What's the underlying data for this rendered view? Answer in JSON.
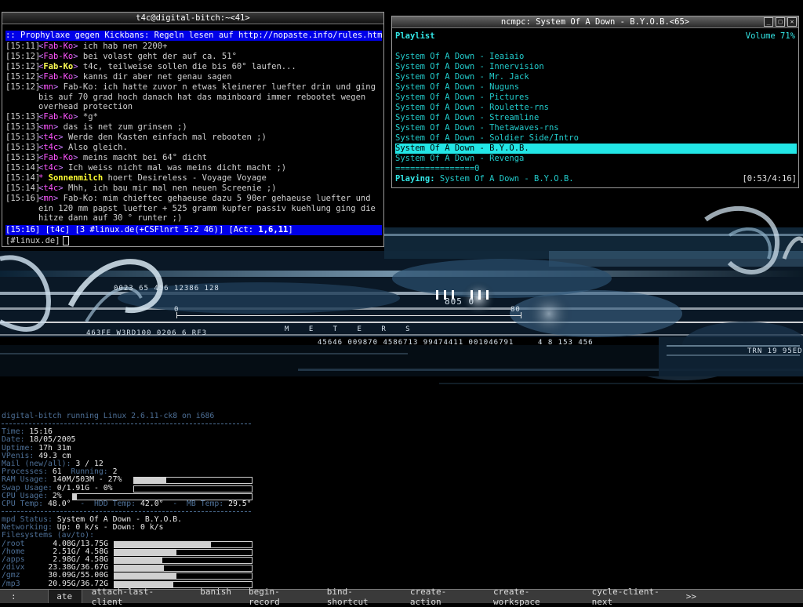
{
  "irc_window": {
    "title": "t4c@digital-bitch:~<41>",
    "topic": ":: Prophylaxe gegen Kickbans: Regeln lesen auf http://nopaste.info/rules.html :",
    "lines": [
      {
        "ts": "[15:11]",
        "nick": "Fab-Ko",
        "kind": "fab",
        "text": "ich hab nen 2200+"
      },
      {
        "ts": "[15:12]",
        "nick": "Fab-Ko",
        "kind": "fab",
        "text": "bei volast geht der auf ca. 51°"
      },
      {
        "ts": "[15:12]",
        "nick": "Fab-Ko",
        "kind": "fabhl",
        "text": "t4c, teilweise sollen die bis 60° laufen..."
      },
      {
        "ts": "[15:12]",
        "nick": "Fab-Ko",
        "kind": "fab",
        "text": "kanns dir aber net genau sagen"
      },
      {
        "ts": "[15:12]",
        "nick": "mn",
        "kind": "mn",
        "text": "Fab-Ko: ich hatte zuvor n etwas kleinerer luefter drin und ging bis auf 70 grad hoch danach hat das mainboard immer rebootet wegen overhead protection"
      },
      {
        "ts": "[15:13]",
        "nick": "Fab-Ko",
        "kind": "fab",
        "text": "*g*"
      },
      {
        "ts": "[15:13]",
        "nick": "mn",
        "kind": "mn",
        "text": "das is net zum grinsen ;)"
      },
      {
        "ts": "[15:13]",
        "nick": "t4c",
        "kind": "t4c",
        "text": "Werde den Kasten einfach mal rebooten ;)"
      },
      {
        "ts": "[15:13]",
        "nick": "t4c",
        "kind": "t4c",
        "text": "Also gleich."
      },
      {
        "ts": "[15:13]",
        "nick": "Fab-Ko",
        "kind": "fab",
        "text": "meins macht bei 64° dicht"
      },
      {
        "ts": "[15:14]",
        "nick": "t4c",
        "kind": "t4c",
        "text": "Ich weiss nicht mal was meins dicht macht ;)"
      },
      {
        "ts": "[15:14]",
        "nick": "Sonnenmilch",
        "kind": "action",
        "text": "hoert Desireless - Voyage Voyage"
      },
      {
        "ts": "[15:14]",
        "nick": "t4c",
        "kind": "t4c",
        "text": "Mhh, ich bau mir mal nen neuen Screenie ;)"
      },
      {
        "ts": "[15:16]",
        "nick": "mn",
        "kind": "mn",
        "text": "Fab-Ko: mim chieftec gehaeuse dazu 5 90er gehaeuse luefter und ein 120 mm papst luefter + 525 gramm kupfer passiv kuehlung ging die hitze dann auf 30 ° runter ;)"
      }
    ],
    "status_bar": "[15:16] [t4c] [3 #linux.de(+CSFlnrt 5:2 46)] [Act: 1,6,11]",
    "status_prefix": "[15:16] [t4c] [3 #linux.de(+CSFlnrt 5:2 46)] [Act: ",
    "status_act": "1,6,11",
    "status_suffix": "]",
    "input_prompt": "[#linux.de]"
  },
  "ncmpc_window": {
    "title": "ncmpc: System Of A Down - B.Y.O.B.<65>",
    "header_left": "Playlist",
    "header_right": "Volume 71%",
    "playlist": [
      "System Of A Down - Ieaiaio",
      "System Of A Down - Innervision",
      "System Of A Down - Mr. Jack",
      "System Of A Down - Nuguns",
      "System Of A Down - Pictures",
      "System Of A Down - Roulette-rns",
      "System Of A Down - Streamline",
      "System Of A Down - Thetawaves-rns",
      "System Of A Down - Soldier Side/Intro",
      "System Of A Down - B.Y.O.B.",
      "System Of A Down - Revenga"
    ],
    "selected_index": 9,
    "progress_text": "================0",
    "playing_label": "Playing:",
    "playing_song": "System Of A Down - B.Y.O.B.",
    "playing_time": "[0:53/4:16]"
  },
  "sysmon": {
    "header": "digital-bitch running Linux 2.6.11-ck8 on i686",
    "rows1": [
      {
        "label": "Time:",
        "value": "15:16"
      },
      {
        "label": "Date:",
        "value": "18/05/2005"
      },
      {
        "label": "Uptime:",
        "value": "17h 31m"
      },
      {
        "label": "VPenis:",
        "value": "49.3 cm"
      },
      {
        "label": "Mail (new/all):",
        "value": "3 / 12"
      },
      {
        "label": "Processes:",
        "value": "61",
        "label2": "Running:",
        "value2": "2"
      },
      {
        "label": "RAM Usage:",
        "value": "140M/503M - 27%",
        "bar": 0.27
      },
      {
        "label": "Swap Usage:",
        "value": "0/1.91G - 0%",
        "bar": 0.0
      },
      {
        "label": "CPU Usage:",
        "value": "2%",
        "bar": 0.02
      }
    ],
    "cpu_temp_label": "CPU Temp:",
    "cpu_temp": "48.0°",
    "hdd_temp_label": "HDD Temp:",
    "hdd_temp": "42.0°",
    "mb_temp_label": "MB Temp:",
    "mb_temp": "29.5°",
    "mpd_label": "mpd Status:",
    "mpd_value": "System Of A Down - B.Y.O.B.",
    "net_label": "Networking:",
    "net_value": "Up: 0 k/s - Down: 0 k/s",
    "fs_header": "Filesystems (av/to):",
    "filesystems": [
      {
        "mount": "/root",
        "value": "4.08G/13.75G",
        "used": 0.7
      },
      {
        "mount": "/home",
        "value": "2.51G/ 4.58G",
        "used": 0.45
      },
      {
        "mount": "/apps",
        "value": "2.98G/ 4.58G",
        "used": 0.35
      },
      {
        "mount": "/divx",
        "value": "23.38G/36.67G",
        "used": 0.36
      },
      {
        "mount": "/gmz",
        "value": "30.09G/55.00G",
        "used": 0.45
      },
      {
        "mount": "/mp3",
        "value": "20.95G/36.72G",
        "used": 0.43
      }
    ]
  },
  "wallpaper_text": {
    "codes1": "0023 65 456 12386 128",
    "center_num": "805 0",
    "scale_0": "0",
    "scale_80": "80",
    "meters": "M E T E R S",
    "codes2": "45646 009870 4586713 99474411 001046791",
    "codes3": "4 8  153 456",
    "codes4": "463FE W3RD100 0206 6 RF3",
    "trn": "TRN 19 95ED"
  },
  "ratpoison_bar": {
    "prompt": ":",
    "entry": "ate",
    "options": [
      "attach-last-client",
      "banish",
      "begin-record",
      "bind-shortcut",
      "create-action",
      "create-workspace",
      "cycle-client-next"
    ],
    "more": ">>"
  }
}
